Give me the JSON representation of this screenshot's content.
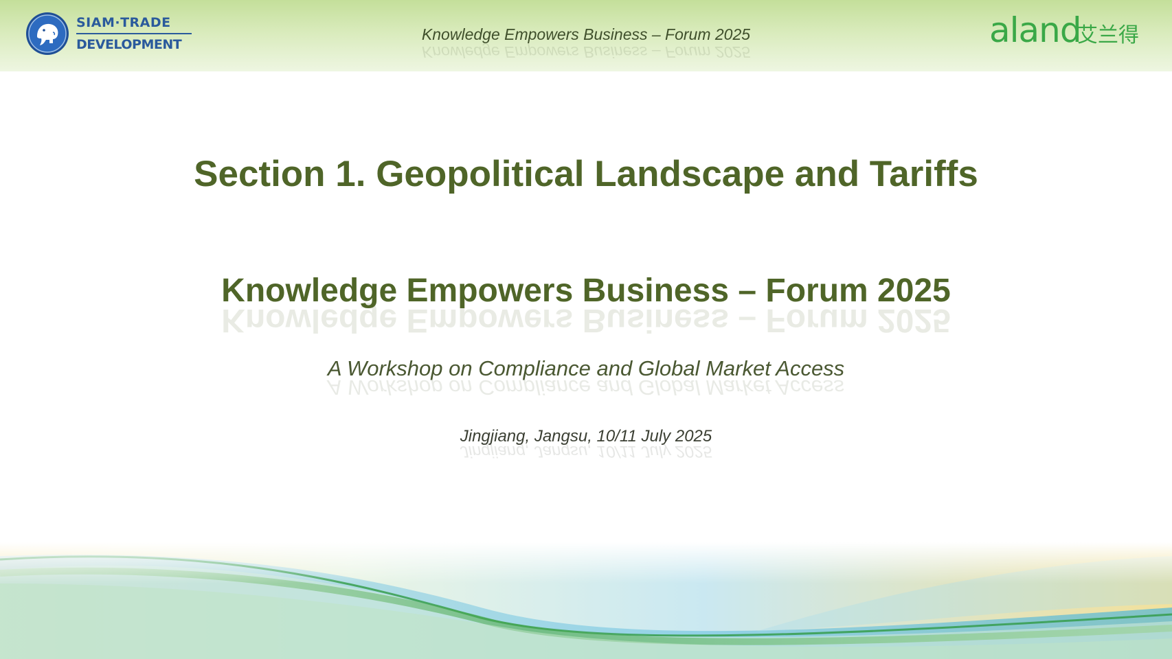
{
  "header": {
    "left_logo": {
      "line1": "SIAM·TRADE",
      "line2": "DEVELOPMENT",
      "icon": "elephant-emblem-icon"
    },
    "title": "Knowledge Empowers Business – Forum 2025",
    "right_logo": {
      "wordmark": "aland",
      "chinese": "艾兰得"
    }
  },
  "main": {
    "section_title": "Section 1. Geopolitical Landscape and Tariffs",
    "forum_title": "Knowledge Empowers Business – Forum 2025",
    "workshop_subtitle": "A Workshop on Compliance and Global Market Access",
    "location_date": "Jingjiang, Jangsu, 10/11 July 2025"
  },
  "colors": {
    "title_green": "#4f6528",
    "aland_green": "#3aa847",
    "siam_blue": "#2a5a9c",
    "band_top": "#c4df9a",
    "band_bottom": "#eef6e2"
  }
}
